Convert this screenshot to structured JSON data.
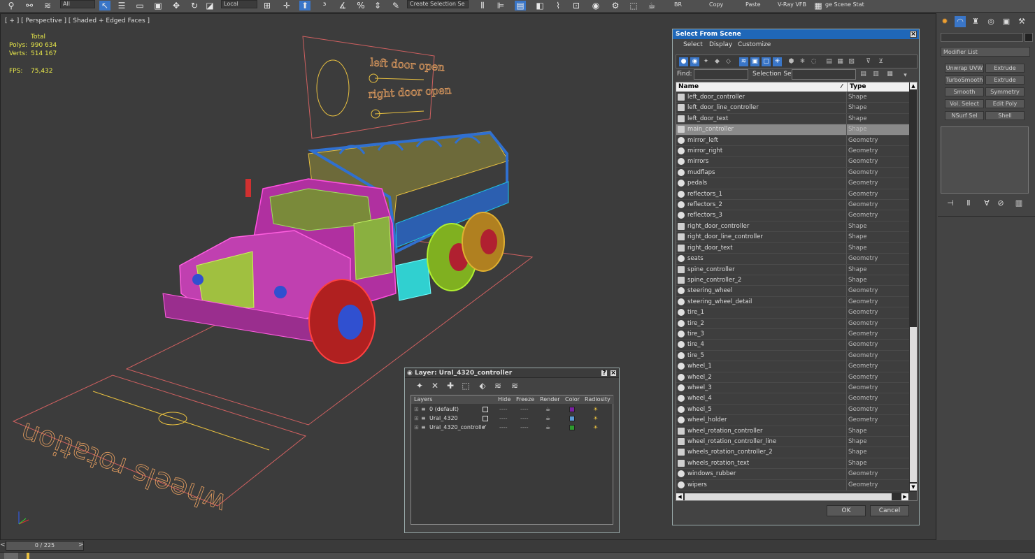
{
  "toolbar": {
    "dropdown_all": "All",
    "dropdown_ref": "Local",
    "selection_set": "Create Selection Se",
    "br": "BR",
    "copy": "Copy",
    "paste": "Paste",
    "vray": "V-Ray VFB",
    "scene": "ge Scene Stat"
  },
  "viewport": {
    "label": "[ + ] [ Perspective ] [ Shaded + Edged Faces ]",
    "total": "Total",
    "polys_label": "Polys:",
    "polys": "990 634",
    "verts_label": "Verts:",
    "verts": "514 167",
    "fps_label": "FPS:",
    "fps": "75,432",
    "left_door": "left door open",
    "right_door": "right door open",
    "wheels": "wheels rotation"
  },
  "right_panel": {
    "modifier_list": "Modifier List",
    "buttons": [
      "Unwrap UVW",
      "Extrude",
      "TurboSmooth",
      "Extrude",
      "Smooth",
      "Symmetry",
      "Vol. Select",
      "Edit Poly",
      "NSurf Sel",
      "Shell"
    ]
  },
  "select_from_scene": {
    "title": "Select From Scene",
    "menu": [
      "Select",
      "Display",
      "Customize"
    ],
    "find_label": "Find:",
    "selection_set_label": "Selection Set:",
    "col_name": "Name",
    "col_type": "Type",
    "ok": "OK",
    "cancel": "Cancel",
    "rows": [
      {
        "name": "left_door_controller",
        "type": "Shape"
      },
      {
        "name": "left_door_line_controller",
        "type": "Shape"
      },
      {
        "name": "left_door_text",
        "type": "Shape"
      },
      {
        "name": "main_controller",
        "type": "Shape"
      },
      {
        "name": "mirror_left",
        "type": "Geometry"
      },
      {
        "name": "mirror_right",
        "type": "Geometry"
      },
      {
        "name": "mirrors",
        "type": "Geometry"
      },
      {
        "name": "mudflaps",
        "type": "Geometry"
      },
      {
        "name": "pedals",
        "type": "Geometry"
      },
      {
        "name": "reflectors_1",
        "type": "Geometry"
      },
      {
        "name": "reflectors_2",
        "type": "Geometry"
      },
      {
        "name": "reflectors_3",
        "type": "Geometry"
      },
      {
        "name": "right_door_controller",
        "type": "Shape"
      },
      {
        "name": "right_door_line_controller",
        "type": "Shape"
      },
      {
        "name": "right_door_text",
        "type": "Shape"
      },
      {
        "name": "seats",
        "type": "Geometry"
      },
      {
        "name": "spine_controller",
        "type": "Shape"
      },
      {
        "name": "spine_controller_2",
        "type": "Shape"
      },
      {
        "name": "steering_wheel",
        "type": "Geometry"
      },
      {
        "name": "steering_wheel_detail",
        "type": "Geometry"
      },
      {
        "name": "tire_1",
        "type": "Geometry"
      },
      {
        "name": "tire_2",
        "type": "Geometry"
      },
      {
        "name": "tire_3",
        "type": "Geometry"
      },
      {
        "name": "tire_4",
        "type": "Geometry"
      },
      {
        "name": "tire_5",
        "type": "Geometry"
      },
      {
        "name": "wheel_1",
        "type": "Geometry"
      },
      {
        "name": "wheel_2",
        "type": "Geometry"
      },
      {
        "name": "wheel_3",
        "type": "Geometry"
      },
      {
        "name": "wheel_4",
        "type": "Geometry"
      },
      {
        "name": "wheel_5",
        "type": "Geometry"
      },
      {
        "name": "wheel_holder",
        "type": "Geometry"
      },
      {
        "name": "wheel_rotation_controller",
        "type": "Shape"
      },
      {
        "name": "wheel_rotation_controller_line",
        "type": "Shape"
      },
      {
        "name": "wheels_rotation_controller_2",
        "type": "Shape"
      },
      {
        "name": "wheels_rotation_text",
        "type": "Shape"
      },
      {
        "name": "windows_rubber",
        "type": "Geometry"
      },
      {
        "name": "wipers",
        "type": "Geometry"
      }
    ],
    "selected_index": 3
  },
  "layer_dialog": {
    "title": "Layer: Ural_4320_controller",
    "col_layers": "Layers",
    "col_hide": "Hide",
    "col_freeze": "Freeze",
    "col_render": "Render",
    "col_color": "Color",
    "col_radiosity": "Radiosity",
    "layers": [
      {
        "name": "0 (default)",
        "color": "#7b1fa2"
      },
      {
        "name": "Ural_4320",
        "color": "#5b9bd5"
      },
      {
        "name": "Ural_4320_controlle",
        "color": "#2e9b2e"
      }
    ]
  },
  "timeline": {
    "frame": "0 / 225"
  }
}
